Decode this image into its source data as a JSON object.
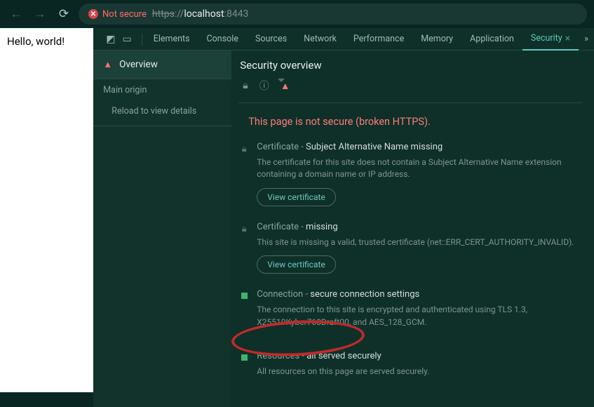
{
  "topBar": {
    "notSecureLabel": "Not secure",
    "urlScheme": "https",
    "urlSchemeSep": "://",
    "urlHost": "localhost",
    "urlPort": ":8443"
  },
  "page": {
    "content": "Hello, world!"
  },
  "devtools": {
    "tabs": [
      "Elements",
      "Console",
      "Sources",
      "Network",
      "Performance",
      "Memory",
      "Application",
      "Security"
    ],
    "activeTab": "Security",
    "sidebar": {
      "overview": "Overview",
      "mainOrigin": "Main origin",
      "reload": "Reload to view details"
    },
    "content": {
      "title": "Security overview",
      "insecureHeading": "This page is not secure (broken HTTPS).",
      "cert1": {
        "label": "Certificate",
        "status": "Subject Alternative Name missing",
        "desc": "The certificate for this site does not contain a Subject Alternative Name extension containing a domain name or IP address.",
        "button": "View certificate"
      },
      "cert2": {
        "label": "Certificate",
        "status": "missing",
        "desc": "This site is missing a valid, trusted certificate (net::ERR_CERT_AUTHORITY_INVALID).",
        "button": "View certificate"
      },
      "conn": {
        "label": "Connection",
        "status": "secure connection settings",
        "desc": "The connection to this site is encrypted and authenticated using TLS 1.3, X25519Kyber768Draft00, and AES_128_GCM."
      },
      "res": {
        "label": "Resources",
        "status": "all served securely",
        "desc": "All resources on this page are served securely."
      }
    }
  }
}
